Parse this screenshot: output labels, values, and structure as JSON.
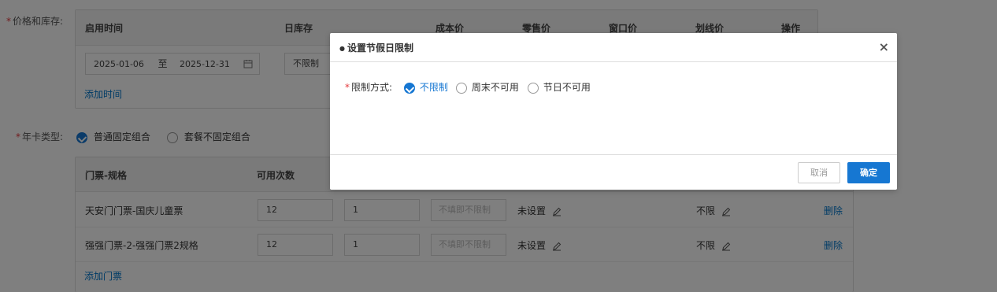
{
  "price_stock": {
    "label": "价格和库存:",
    "headers": [
      "启用时间",
      "日库存",
      "成本价",
      "零售价",
      "窗口价",
      "划线价",
      "操作"
    ],
    "start_date": "2025-01-06",
    "to_label": "至",
    "end_date": "2025-12-31",
    "stock_value": "不限制",
    "add_time": "添加时间"
  },
  "card_type": {
    "label": "年卡类型:",
    "options": [
      "普通固定组合",
      "套餐不固定组合"
    ],
    "selected": 0
  },
  "tickets": {
    "headers": [
      "门票-规格",
      "可用次数"
    ],
    "rows": [
      {
        "name": "天安门门票-国庆儿童票",
        "count": "12",
        "qty": "1",
        "placeholder": "不填即不限制",
        "setting": "未设置",
        "limit": "不限",
        "delete": "删除"
      },
      {
        "name": "强强门票-2-强强门票2规格",
        "count": "12",
        "qty": "1",
        "placeholder": "不填即不限制",
        "setting": "未设置",
        "limit": "不限",
        "delete": "删除"
      }
    ],
    "add_ticket": "添加门票"
  },
  "modal": {
    "title": "设置节假日限制",
    "close": "×",
    "field_label": "限制方式:",
    "options": [
      "不限制",
      "周末不可用",
      "节日不可用"
    ],
    "selected": 0,
    "cancel": "取消",
    "confirm": "确定"
  },
  "colors": {
    "accent": "#1677d2",
    "link": "#0077cc",
    "required": "#e4393c"
  }
}
